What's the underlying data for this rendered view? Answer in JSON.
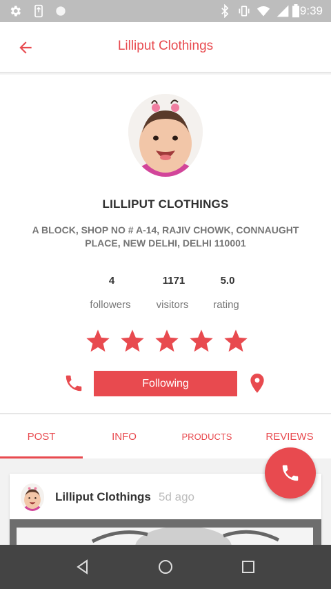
{
  "status_bar": {
    "time": "9:39",
    "left_icons": [
      "settings-icon",
      "screenshot-icon",
      "circle-icon"
    ],
    "right_icons": [
      "bluetooth-icon",
      "vibrate-icon",
      "wifi-icon",
      "signal-icon",
      "battery-icon"
    ]
  },
  "app_bar": {
    "title": "Lilliput Clothings",
    "back_icon": "arrow-back-icon"
  },
  "profile": {
    "name": "LILLIPUT CLOTHINGS",
    "address": "A BLOCK, SHOP NO # A-14, RAJIV CHOWK, CONNAUGHT PLACE, NEW DELHI, DELHI 110001",
    "stats": [
      {
        "value": "4",
        "label": "followers"
      },
      {
        "value": "1171",
        "label": "visitors"
      },
      {
        "value": "5.0",
        "label": "rating"
      }
    ],
    "rating_stars": 5,
    "follow_button": "Following"
  },
  "tabs": [
    {
      "label": "POST",
      "active": true
    },
    {
      "label": "INFO",
      "active": false
    },
    {
      "label": "PRODUCTS",
      "active": false
    },
    {
      "label": "REVIEWS",
      "active": false
    }
  ],
  "post": {
    "author": "Lilliput Clothings",
    "time": "5d ago"
  },
  "colors": {
    "accent": "#e84a4f",
    "status_bar": "#bdbdbd",
    "nav_bar": "#444444"
  }
}
